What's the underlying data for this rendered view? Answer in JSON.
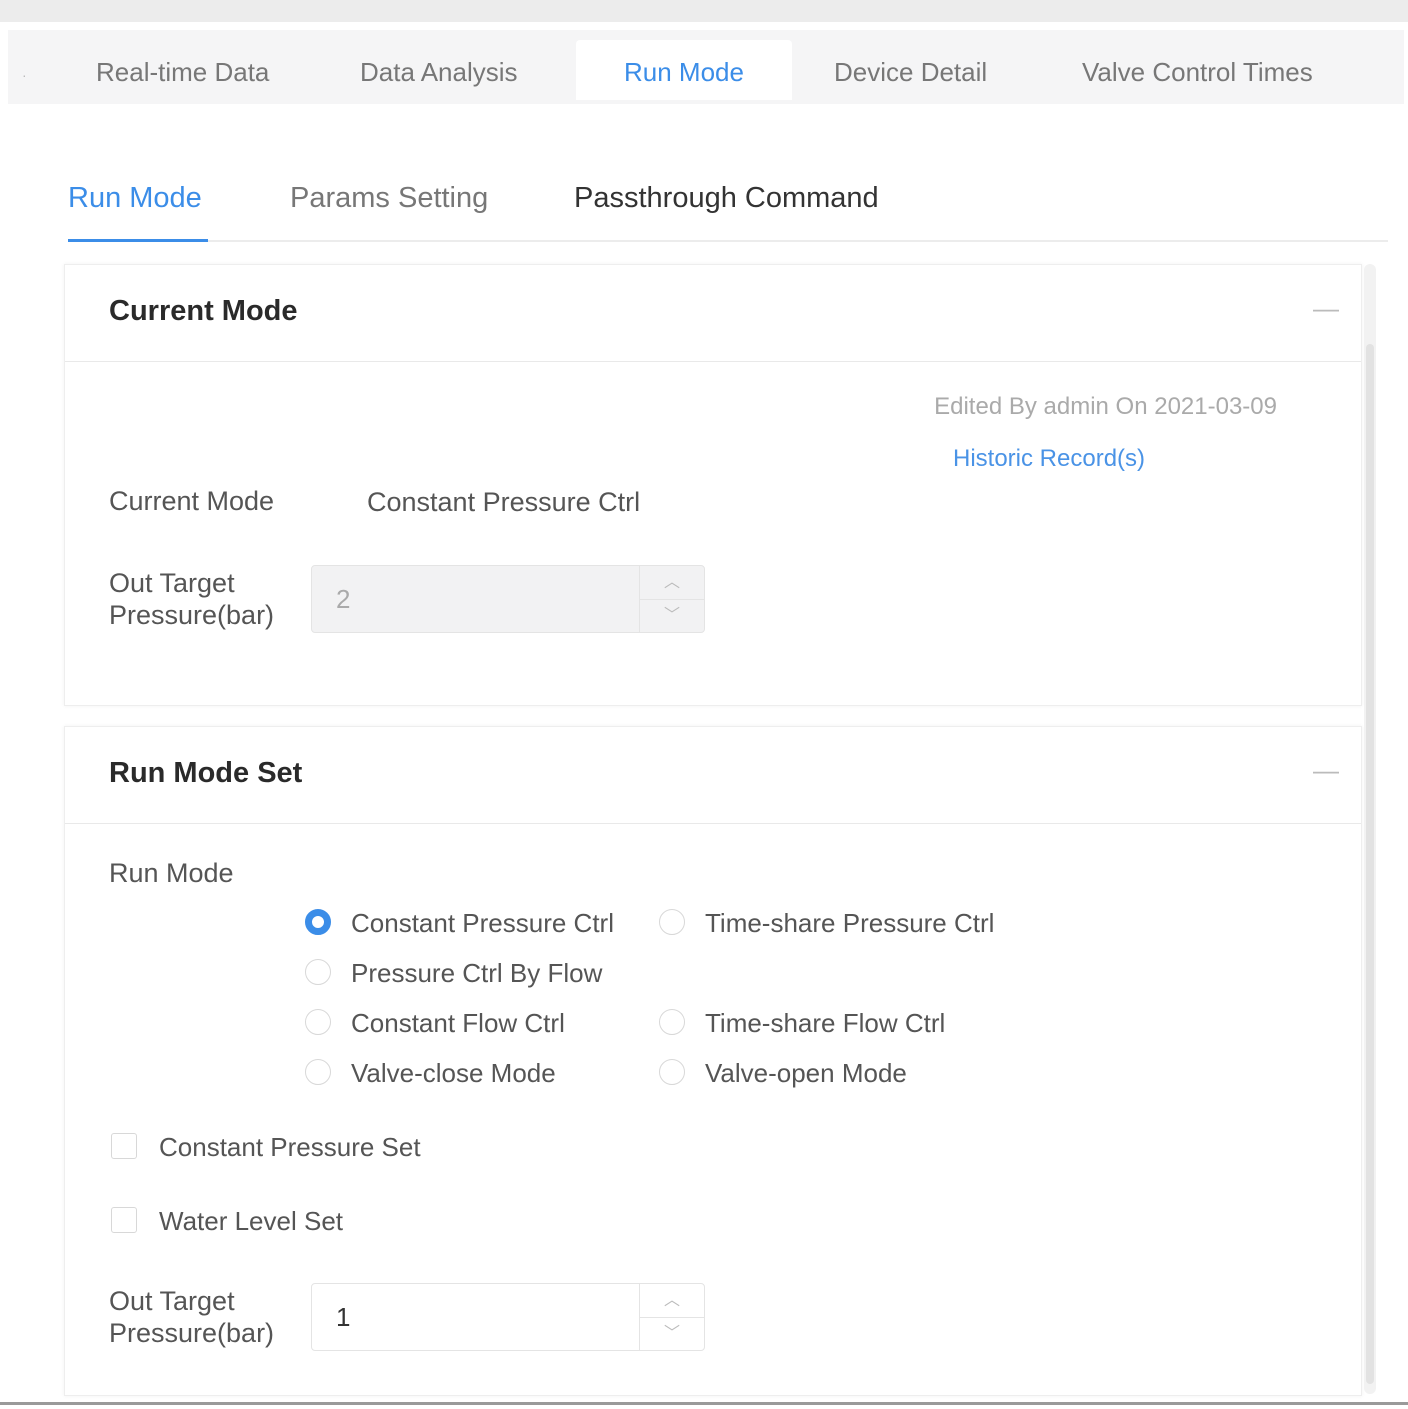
{
  "top_tabs": [
    {
      "label": "Real-time Data",
      "active": false
    },
    {
      "label": "Data Analysis",
      "active": false
    },
    {
      "label": "Run Mode",
      "active": true
    },
    {
      "label": "Device Detail",
      "active": false
    },
    {
      "label": "Valve Control Times",
      "active": false
    }
  ],
  "sub_tabs": [
    {
      "label": "Run Mode",
      "active": true
    },
    {
      "label": "Params Setting",
      "active": false
    },
    {
      "label": "Passthrough Command",
      "active": false
    }
  ],
  "current_mode_card": {
    "title": "Current Mode",
    "collapse_glyph": "—",
    "edited_text": "Edited By admin On 2021-03-09",
    "history_link": "Historic Record(s)",
    "mode_label": "Current Mode",
    "mode_value": "Constant Pressure Ctrl",
    "target_label": "Out Target Pressure(bar)",
    "target_value": "2"
  },
  "run_mode_card": {
    "title": "Run Mode Set",
    "collapse_glyph": "—",
    "run_mode_label": "Run Mode",
    "options": [
      {
        "label": "Constant Pressure Ctrl",
        "checked": true
      },
      {
        "label": "Time-share Pressure Ctrl",
        "checked": false
      },
      {
        "label": "Pressure Ctrl By Flow",
        "checked": false
      },
      {
        "label": "Constant Flow Ctrl",
        "checked": false
      },
      {
        "label": "Time-share Flow Ctrl",
        "checked": false
      },
      {
        "label": "Valve-close Mode",
        "checked": false
      },
      {
        "label": "Valve-open Mode",
        "checked": false
      }
    ],
    "checkbox_constant_pressure": "Constant Pressure Set",
    "checkbox_water_level": "Water Level Set",
    "target_label": "Out Target Pressure(bar)",
    "target_value": "1"
  },
  "colors": {
    "accent": "#3b8de8",
    "text": "#555555",
    "border": "#e4e4e4"
  },
  "icons": {
    "collapse": "minus-icon",
    "spinner_up": "chevron-up-icon",
    "spinner_down": "chevron-down-icon"
  }
}
